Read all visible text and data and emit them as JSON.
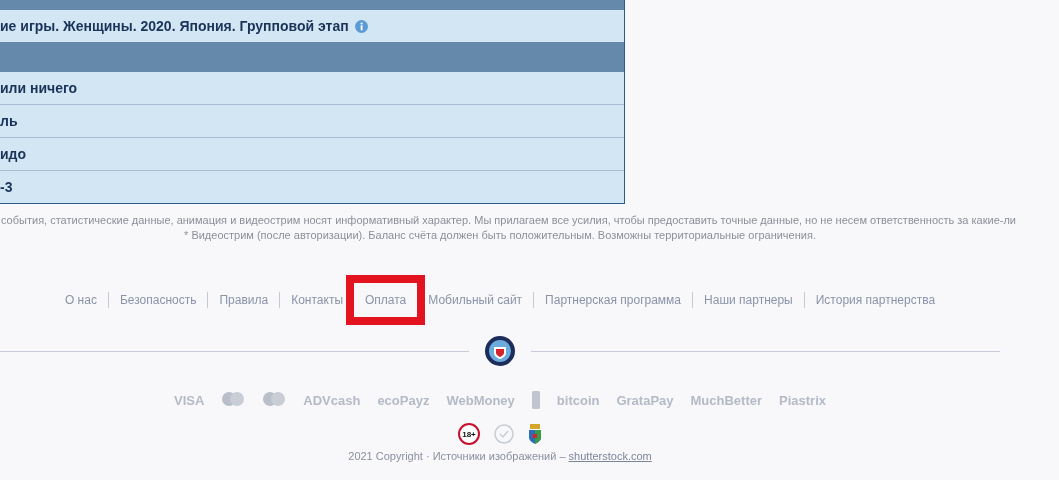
{
  "table": {
    "rows": [
      {
        "kind": "band"
      },
      {
        "kind": "title",
        "text": "ие игры. Женщины. 2020. Япония. Групповой этап",
        "info": true
      },
      {
        "kind": "band"
      },
      {
        "kind": "row",
        "text": "или ничего"
      },
      {
        "kind": "row",
        "text": "ль"
      },
      {
        "kind": "row",
        "text": "идо"
      },
      {
        "kind": "row",
        "text": "-3"
      }
    ]
  },
  "disclaimer": [
    "события, статистические данные, анимация и видеострим носят информативный характер. Мы прилагаем все усилия, чтобы предоставить точные данные, но не несем ответственность за какие-ли",
    "* Видеострим (после авторизации). Баланс счёта должен быть положительным. Возможны территориальные ограничения."
  ],
  "footer_links": [
    {
      "label": "О нас",
      "highlighted": false
    },
    {
      "label": "Безопасность",
      "highlighted": false
    },
    {
      "label": "Правила",
      "highlighted": false
    },
    {
      "label": "Контакты",
      "highlighted": false
    },
    {
      "label": "Оплата",
      "highlighted": true
    },
    {
      "label": "Мобильный сайт",
      "highlighted": false
    },
    {
      "label": "Партнерская программа",
      "highlighted": false
    },
    {
      "label": "Наши партнеры",
      "highlighted": false
    },
    {
      "label": "История партнерства",
      "highlighted": false
    }
  ],
  "payments": [
    {
      "kind": "wordmark",
      "label": "VISA"
    },
    {
      "kind": "circles"
    },
    {
      "kind": "circles"
    },
    {
      "kind": "wordmark",
      "label": "ADVcash"
    },
    {
      "kind": "wordmark",
      "label": "ecoPayz"
    },
    {
      "kind": "wordmark",
      "label": "WebMoney"
    },
    {
      "kind": "phone"
    },
    {
      "kind": "wordmark",
      "label": "bitcoin"
    },
    {
      "kind": "wordmark",
      "label": "GrataPay"
    },
    {
      "kind": "wordmark",
      "label": "MuchBetter"
    },
    {
      "kind": "wordmark",
      "label": "Piastrix"
    }
  ],
  "age_badge": "18+",
  "copyright": {
    "text": "2021 Copyright · Источники изображений –",
    "link": "shutterstock.com"
  }
}
